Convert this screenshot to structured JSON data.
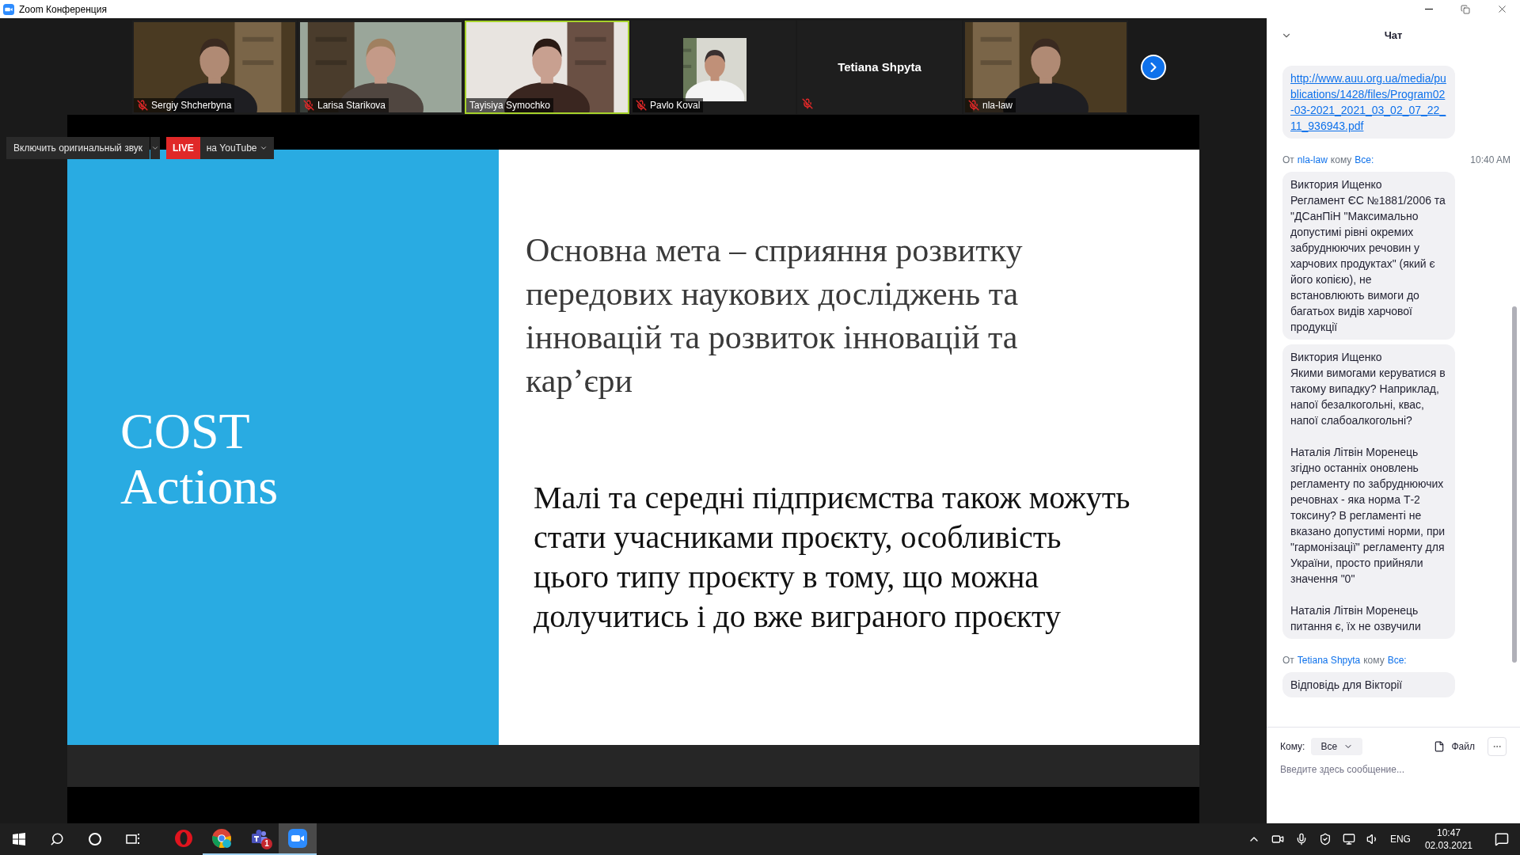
{
  "window": {
    "title": "Zoom Конференция"
  },
  "participants": [
    {
      "name": "Sergiy Shcherbyna",
      "kind": "video",
      "muted": true,
      "selected": false
    },
    {
      "name": "Larisa Starikova",
      "kind": "video",
      "muted": true,
      "selected": false
    },
    {
      "name": "Tayisiya Symochko",
      "kind": "video",
      "muted": false,
      "selected": true
    },
    {
      "name": "Pavlo Koval",
      "kind": "video_small",
      "muted": true,
      "selected": false
    },
    {
      "name": "Tetiana Shpyta",
      "kind": "name_only",
      "muted": true,
      "selected": false
    },
    {
      "name": "nla-law",
      "kind": "video",
      "muted": true,
      "selected": false
    }
  ],
  "toolbar": {
    "original_audio_button": "Включить оригинальный звук",
    "live_badge": "LIVE",
    "stream_button": "на YouTube"
  },
  "slide": {
    "title": "COST Actions",
    "heading": "Основна мета – сприяння розвитку передових наукових досліджень та інновацій та розвиток інновацій та кар’єри",
    "body": "Малі та середні підприємства також можуть стати учасниками проєкту, особливість цього типу проєкту в тому, що можна долучитись і до вже виграного проєкту"
  },
  "chat": {
    "title": "Чат",
    "groups": [
      {
        "messages": [
          {
            "kind": "link",
            "text": "http://www.auu.org.ua/media/publications/1428/files/Program02-03-2021_2021_03_02_07_22_11_936943.pdf"
          }
        ]
      },
      {
        "header": {
          "from": "От",
          "sender": "nla-law",
          "to": "кому",
          "recipient": "Все:",
          "time": "10:40 AM"
        },
        "messages": [
          {
            "kind": "text",
            "text": "Виктория Ищенко\nРегламент ЄС №1881/2006 та \"ДСанПіН \"Максимально допустимі рівні окремих забруднюючих речовин у харчових продуктах\" (який є його копією), не встановлюють вимоги до багатьох видів харчової продукції"
          },
          {
            "kind": "text",
            "text": "Виктория Ищенко\nЯкими вимогами керуватися в такому випадку? Наприклад, напої безалкогольні, квас, напої слабоалкогольні?\n\nНаталія Літвін Моренець\nзгідно останніх оновлень регламенту по забруднюючих речовнах - яка норма Т-2 токсину? В регламенті не вказано допустимі норми, при \"гармонізації\" регламенту для України, просто прийняли значення \"0\"\n\nНаталія Літвін Моренець\nпитання є, їх не озвучили"
          }
        ]
      },
      {
        "header": {
          "from": "От",
          "sender": "Tetiana Shpyta",
          "to": "кому",
          "recipient": "Все:"
        },
        "messages": [
          {
            "kind": "text",
            "text": "Відповідь для Вікторії"
          }
        ]
      }
    ],
    "to_label": "Кому:",
    "to_value": "Все",
    "file_button": "Файл",
    "placeholder": "Введите здесь сообщение..."
  },
  "taskbar": {
    "apps": [
      {
        "kind": "opera",
        "running": false,
        "selected": false
      },
      {
        "kind": "chrome",
        "running": true,
        "selected": false
      },
      {
        "kind": "teams",
        "running": true,
        "selected": false,
        "badge": "1"
      },
      {
        "kind": "zoom",
        "running": true,
        "selected": true
      }
    ],
    "language": "ENG",
    "time": "10:47",
    "date": "02.03.2021"
  }
}
